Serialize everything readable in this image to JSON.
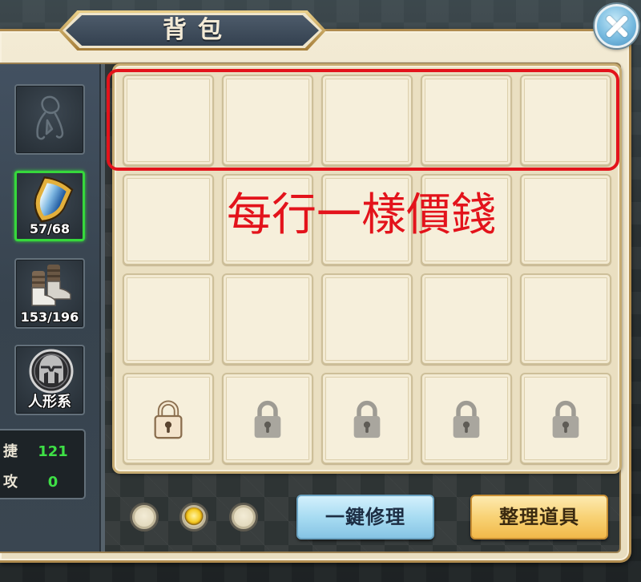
{
  "window": {
    "title": "背包"
  },
  "header": {
    "close_icon": "close-icon"
  },
  "sidebar": {
    "slots": [
      {
        "icon": "amulet-icon",
        "empty": true,
        "selected": false
      },
      {
        "icon": "shield-icon",
        "label": "57/68",
        "selected": true
      },
      {
        "icon": "boots-icon",
        "label": "153/196",
        "selected": false
      },
      {
        "icon": "humanoid-race-icon",
        "label": "人形系",
        "selected": false
      }
    ],
    "stats": [
      {
        "name": "捷",
        "value": "121"
      },
      {
        "name": "攻",
        "value": "0"
      }
    ]
  },
  "inventory": {
    "columns": 5,
    "slots": [
      {
        "locked": false
      },
      {
        "locked": false
      },
      {
        "locked": false
      },
      {
        "locked": false
      },
      {
        "locked": false
      },
      {
        "locked": false
      },
      {
        "locked": false
      },
      {
        "locked": false
      },
      {
        "locked": false
      },
      {
        "locked": false
      },
      {
        "locked": false
      },
      {
        "locked": false
      },
      {
        "locked": false
      },
      {
        "locked": false
      },
      {
        "locked": false
      },
      {
        "locked": true,
        "icon": "lock-icon",
        "next_to_unlock": true
      },
      {
        "locked": true,
        "icon": "lock-icon",
        "next_to_unlock": false
      },
      {
        "locked": true,
        "icon": "lock-icon",
        "next_to_unlock": false
      },
      {
        "locked": true,
        "icon": "lock-icon",
        "next_to_unlock": false
      },
      {
        "locked": true,
        "icon": "lock-icon",
        "next_to_unlock": false
      }
    ]
  },
  "annotation": {
    "highlighted_row": 1,
    "note": "每行一樣價錢",
    "color": "#e3131b"
  },
  "pagination": {
    "total_pages": 3,
    "current_page": 2
  },
  "buttons": {
    "repair_all": "一鍵修理",
    "sort_items": "整理道具"
  },
  "colors": {
    "selected_slot_border": "#36d83c",
    "stat_value": "#3ee046",
    "panel_cream": "#eadfc1",
    "title_banner": "#3d4a58",
    "repair_button": "#a8dcf2",
    "sort_button": "#f8d275",
    "active_page_dot": "#f5cb24"
  }
}
